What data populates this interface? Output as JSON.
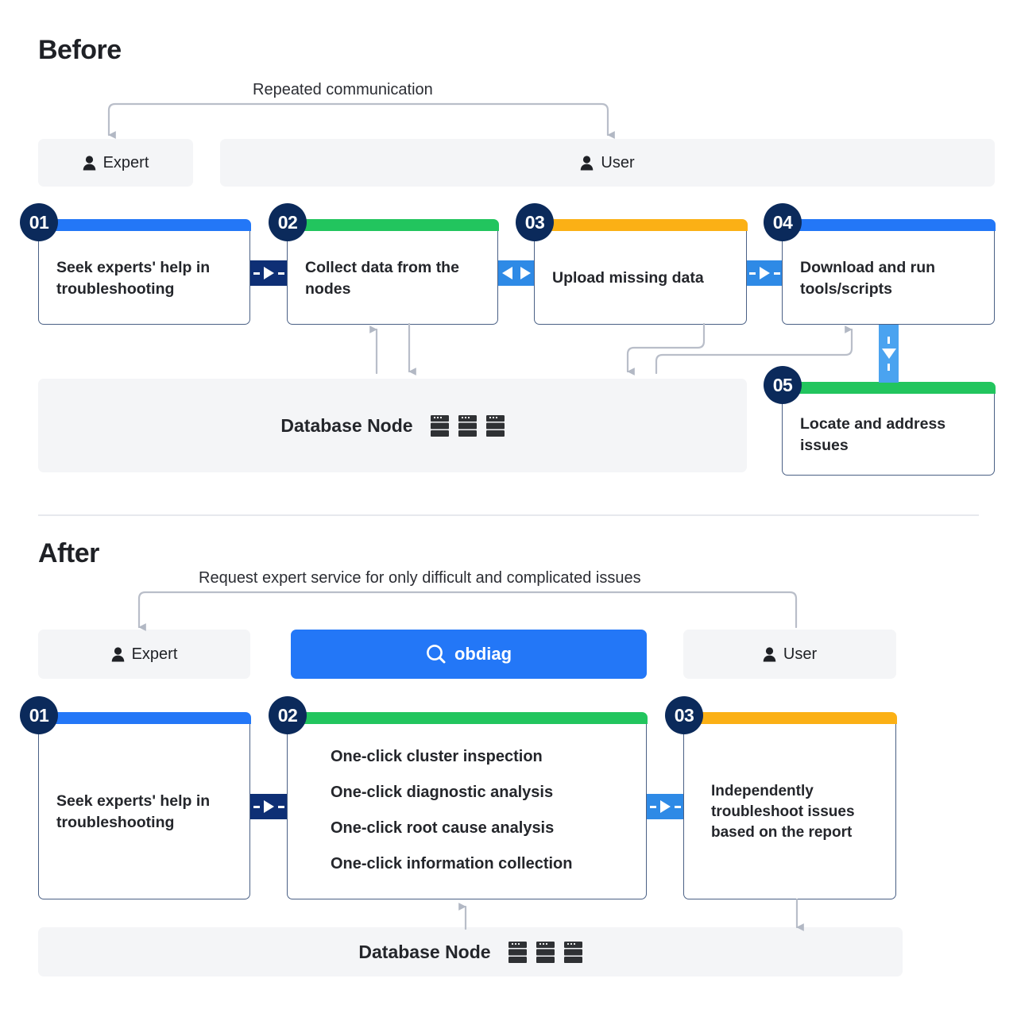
{
  "page": {
    "background": "#ffffff",
    "accents": {
      "blue": "#2377f7",
      "light_blue": "#4aa3f0",
      "navy": "#0b2a5b",
      "green": "#22c55e",
      "amber": "#fbb015",
      "gray_panel": "#f4f5f7",
      "gray_line": "#b9bec9",
      "card_border": "#4a6085"
    }
  },
  "before": {
    "title": "Before",
    "flow_label": "Repeated communication",
    "roles": [
      {
        "label": "Expert",
        "icon": "person-icon"
      },
      {
        "label": "User",
        "icon": "person-icon"
      }
    ],
    "cards": [
      {
        "num": "01",
        "text": "Seek experts' help in troubleshooting",
        "accent": "#2377f7"
      },
      {
        "num": "02",
        "text": "Collect data from the nodes",
        "accent": "#22c55e"
      },
      {
        "num": "03",
        "text": "Upload missing data",
        "accent": "#fbb015"
      },
      {
        "num": "04",
        "text": "Download and run tools/scripts",
        "accent": "#2377f7"
      },
      {
        "num": "05",
        "text": "Locate and address issues",
        "accent": "#22c55e"
      }
    ],
    "connectors": [
      {
        "id": "c1-2",
        "style": "navy",
        "direction": "right"
      },
      {
        "id": "c2-3",
        "style": "blue",
        "direction": "both"
      },
      {
        "id": "c3-4",
        "style": "blue",
        "direction": "right"
      },
      {
        "id": "c4-5",
        "style": "blue-vertical",
        "direction": "down"
      }
    ],
    "database_node": {
      "label": "Database Node",
      "icon": "server-rack-icon",
      "icon_count": 3
    }
  },
  "after": {
    "title": "After",
    "flow_label": "Request expert service for only difficult and complicated issues",
    "roles": [
      {
        "label": "Expert",
        "icon": "person-icon"
      },
      {
        "label": "User",
        "icon": "person-icon"
      }
    ],
    "brand": {
      "label": "obdiag",
      "icon": "magnifier-icon",
      "color": "#2377f7"
    },
    "cards": [
      {
        "num": "01",
        "text": "Seek experts' help in troubleshooting",
        "accent": "#2377f7"
      },
      {
        "num": "02",
        "text": "",
        "accent": "#22c55e",
        "items": [
          "One-click cluster inspection",
          "One-click diagnostic analysis",
          "One-click root cause analysis",
          "One-click information collection"
        ]
      },
      {
        "num": "03",
        "text": "Independently troubleshoot issues based on the report",
        "accent": "#fbb015"
      }
    ],
    "connectors": [
      {
        "id": "a1-2",
        "style": "navy",
        "direction": "right"
      },
      {
        "id": "a2-3",
        "style": "blue",
        "direction": "right"
      }
    ],
    "database_node": {
      "label": "Database Node",
      "icon": "server-rack-icon",
      "icon_count": 3
    }
  }
}
